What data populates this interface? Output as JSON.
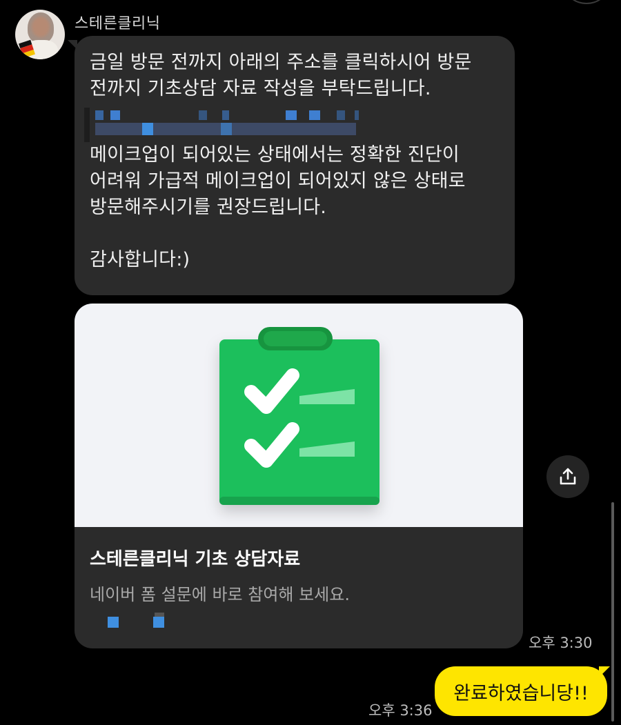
{
  "chat": {
    "sender_name": "스테른클리닉",
    "message_lines": [
      "금일 방문 전까지 아래의 주소를 클릭하시어 방문",
      "전까지 기초상담 자료 작성을 부탁드립니다.",
      "메이크업이 되어있는 상태에서는 정확한 진단이",
      "어려워 가급적 메이크업이 되어있지 않은 상태로",
      "방문해주시기를 권장드립니다.",
      "감사합니다:)"
    ],
    "card": {
      "title": "스테른클리닉 기초 상담자료",
      "description": "네이버 폼 설문에 바로 참여해 보세요.",
      "image_icon": "clipboard-checklist-icon"
    },
    "received_time": "오후 3:30",
    "reply": {
      "text": "완료하였습니당!!",
      "time": "오후 3:36"
    },
    "share_icon": "share-icon"
  },
  "colors": {
    "background": "#000000",
    "received_bubble": "#2b2b2b",
    "my_bubble": "#fee500",
    "clipboard_green": "#1dbf5b",
    "link_blue": "#3f8fe0"
  }
}
